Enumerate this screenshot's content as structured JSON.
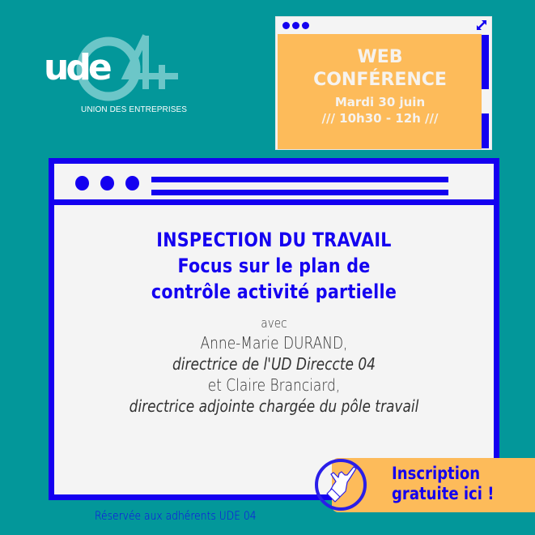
{
  "colors": {
    "background": "#03979a",
    "accent_blue": "#1400f0",
    "orange": "#fdbb5a",
    "window_light": "#f4f4f4"
  },
  "logo": {
    "wordmark": "ude",
    "number": "04",
    "subtitle": "UNION DES ENTREPRISES"
  },
  "conference_window": {
    "title_dots_icon": "window-dots-icon",
    "expand_icon": "expand-arrows-icon",
    "line1": "WEB",
    "line2": "CONFÉRENCE",
    "date": "Mardi 30 juin",
    "time": "/// 10h30 - 12h ///"
  },
  "main_window": {
    "title_dots_icon": "window-dots-icon",
    "menu_lines_icon": "menu-lines-icon",
    "headline": [
      "INSPECTION DU TRAVAIL",
      "Focus sur le plan de",
      "contrôle activité partielle"
    ],
    "avec": "avec",
    "speaker1_name": "Anne-Marie DURAND,",
    "speaker1_role": "directrice de l'UD Direccte 04",
    "speaker2_name": "et Claire Branciard,",
    "speaker2_role": "directrice adjointe chargée du pôle travail"
  },
  "cta": {
    "icon": "pointing-hand-icon",
    "line1": "Inscription",
    "line2": "gratuite ici !"
  },
  "footer": {
    "note": "Réservée aux adhérents UDE 04"
  }
}
